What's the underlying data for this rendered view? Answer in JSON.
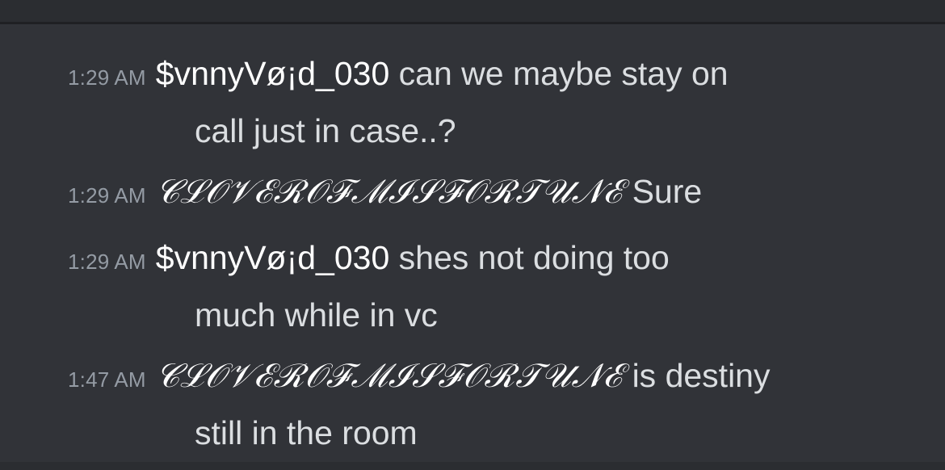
{
  "messages": [
    {
      "time": "1:29 AM",
      "user": "$vnnyVø¡d_030",
      "text_line1": "can we maybe stay on",
      "text_line2": "call just in case..?"
    },
    {
      "time": "1:29 AM",
      "user": "𝒞ℒ𝒪𝒱ℰℛ𝒪ℱℳℐ𝒮ℱ𝒪ℛ𝒯𝒰𝒩ℰ",
      "text_line1": "Sure",
      "text_line2": ""
    },
    {
      "time": "1:29 AM",
      "user": "$vnnyVø¡d_030",
      "text_line1": "shes not doing too",
      "text_line2": "much while in vc"
    },
    {
      "time": "1:47 AM",
      "user": "𝒞ℒ𝒪𝒱ℰℛ𝒪ℱℳℐ𝒮ℱ𝒪ℛ𝒯𝒰𝒩ℰ",
      "text_line1": "is destiny",
      "text_line2": "still in the room"
    }
  ]
}
